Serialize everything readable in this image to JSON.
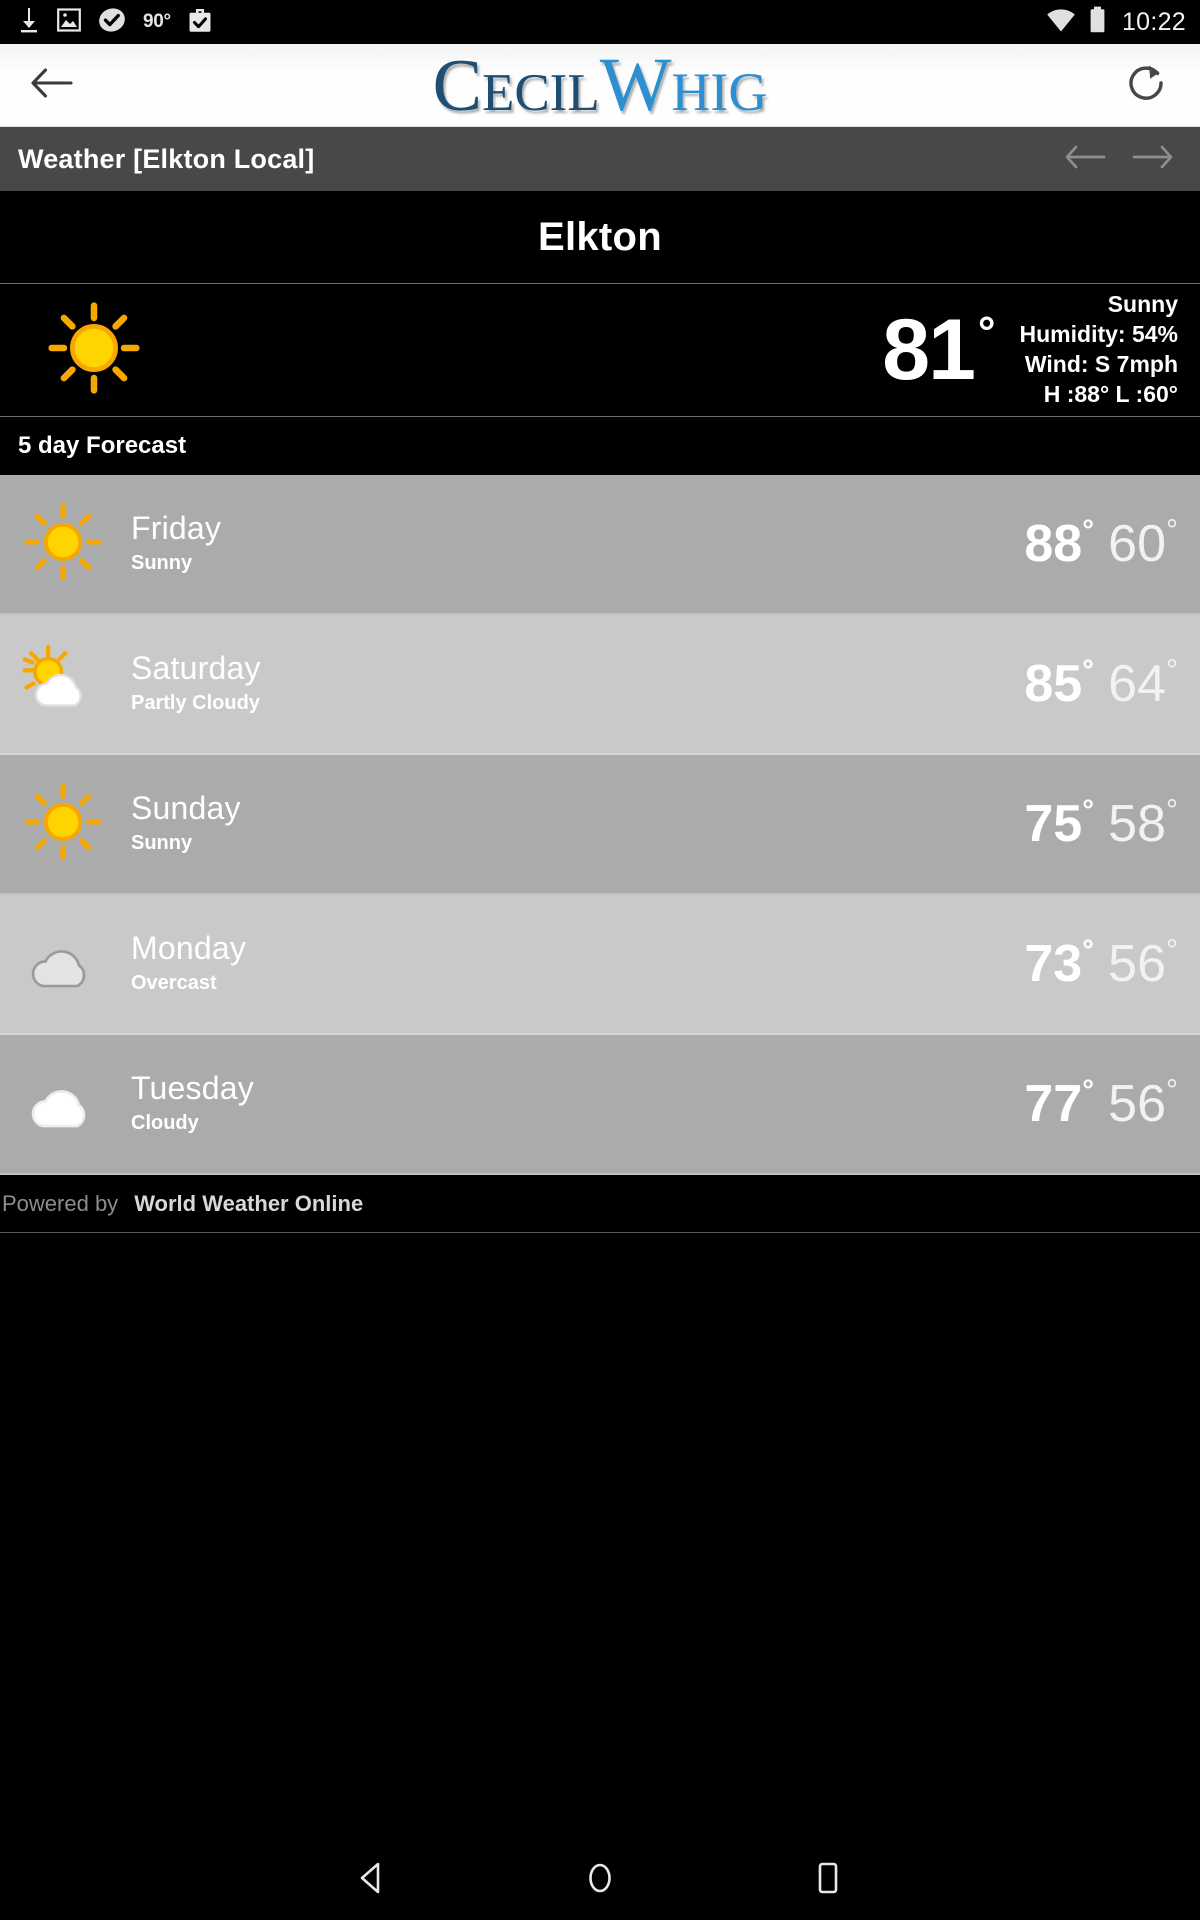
{
  "status_bar": {
    "icons_left": [
      "download-icon",
      "image-icon",
      "skype-check-icon",
      "briefcase-check-icon"
    ],
    "temp_indicator": "90°",
    "icons_right": [
      "wifi-icon",
      "battery-icon"
    ],
    "clock": "10:22"
  },
  "app_bar": {
    "back_icon": "back-arrow-icon",
    "logo": {
      "part1a": "C",
      "part1b": "ECIL",
      "part2a": "W",
      "part2b": "HIG"
    },
    "refresh_icon": "refresh-icon"
  },
  "section_bar": {
    "title": "Weather [Elkton Local]",
    "prev_icon": "arrow-left-icon",
    "next_icon": "arrow-right-icon"
  },
  "city": "Elkton",
  "current": {
    "icon": "sunny-icon",
    "temperature": "81",
    "degree": "°",
    "condition": "Sunny",
    "humidity": "Humidity: 54%",
    "wind": "Wind: S 7mph",
    "highlow": "H :88°   L :60°"
  },
  "forecast": {
    "header": "5 day Forecast",
    "days": [
      {
        "day": "Friday",
        "condition": "Sunny",
        "icon": "sunny-icon",
        "high": "88",
        "low": "60",
        "deg": "°"
      },
      {
        "day": "Saturday",
        "condition": "Partly Cloudy",
        "icon": "partly-cloudy-icon",
        "high": "85",
        "low": "64",
        "deg": "°"
      },
      {
        "day": "Sunday",
        "condition": "Sunny",
        "icon": "sunny-icon",
        "high": "75",
        "low": "58",
        "deg": "°"
      },
      {
        "day": "Monday",
        "condition": "Overcast",
        "icon": "overcast-icon",
        "high": "73",
        "low": "56",
        "deg": "°"
      },
      {
        "day": "Tuesday",
        "condition": "Cloudy",
        "icon": "cloudy-icon",
        "high": "77",
        "low": "56",
        "deg": "°"
      }
    ]
  },
  "footer": {
    "powered_by_label": "Powered by",
    "provider": "World Weather Online"
  },
  "nav_bar": {
    "back_icon": "nav-back-icon",
    "home_icon": "nav-home-icon",
    "recents_icon": "nav-recents-icon"
  },
  "colors": {
    "section_bar_bg": "#484848",
    "row_dark": "#ababab",
    "row_light": "#c9c9c9",
    "logo_dark_blue": "#1d4e73",
    "logo_light_blue": "#2b8fd1",
    "sun_yellow": "#ffd400",
    "sun_orange": "#f5a623"
  }
}
